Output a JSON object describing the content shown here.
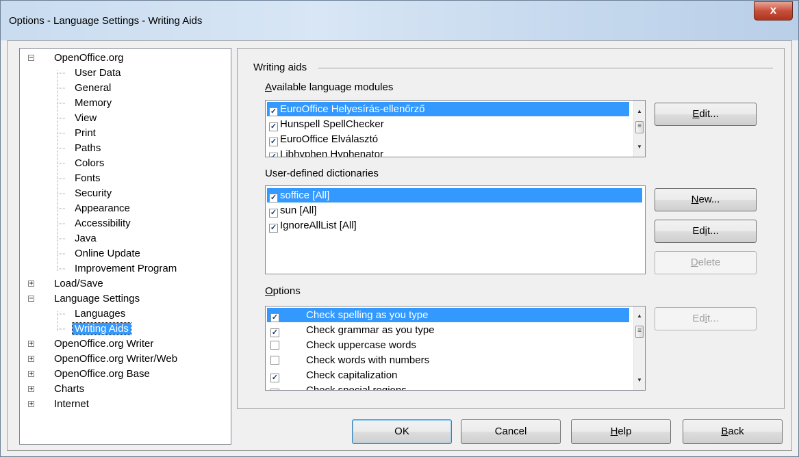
{
  "window": {
    "title": "Options - Language Settings - Writing Aids",
    "close_glyph": "x"
  },
  "tree": {
    "items": [
      {
        "label": "OpenOffice.org",
        "expander": "−"
      },
      {
        "label": "User Data"
      },
      {
        "label": "General"
      },
      {
        "label": "Memory"
      },
      {
        "label": "View"
      },
      {
        "label": "Print"
      },
      {
        "label": "Paths"
      },
      {
        "label": "Colors"
      },
      {
        "label": "Fonts"
      },
      {
        "label": "Security"
      },
      {
        "label": "Appearance"
      },
      {
        "label": "Accessibility"
      },
      {
        "label": "Java"
      },
      {
        "label": "Online Update"
      },
      {
        "label": "Improvement Program"
      },
      {
        "label": "Load/Save",
        "expander": "+"
      },
      {
        "label": "Language Settings",
        "expander": "−"
      },
      {
        "label": "Languages"
      },
      {
        "label": "Writing Aids",
        "selected": true
      },
      {
        "label": "OpenOffice.org Writer",
        "expander": "+"
      },
      {
        "label": "OpenOffice.org Writer/Web",
        "expander": "+"
      },
      {
        "label": "OpenOffice.org Base",
        "expander": "+"
      },
      {
        "label": "Charts",
        "expander": "+"
      },
      {
        "label": "Internet",
        "expander": "+"
      }
    ]
  },
  "panel": {
    "group_title": "Writing aids",
    "modules": {
      "label_prefix": "A",
      "label_rest": "vailable language modules",
      "items": [
        {
          "label": "EuroOffice Helyesírás-ellenőrző",
          "checked": true,
          "selected": true
        },
        {
          "label": "Hunspell SpellChecker",
          "checked": true
        },
        {
          "label": "EuroOffice Elválasztó",
          "checked": true
        },
        {
          "label": "Libhyphen Hyphenator",
          "checked": true
        }
      ],
      "edit_button": {
        "pre": "",
        "key": "E",
        "post": "dit..."
      }
    },
    "dictionaries": {
      "label": "User-defined dictionaries",
      "items": [
        {
          "label": "soffice [All]",
          "checked": true,
          "selected": true
        },
        {
          "label": "sun [All]",
          "checked": true
        },
        {
          "label": "IgnoreAllList [All]",
          "checked": true
        }
      ],
      "new_button": {
        "pre": "",
        "key": "N",
        "post": "ew..."
      },
      "edit_button": {
        "pre": "Ed",
        "key": "i",
        "post": "t..."
      },
      "delete_button": {
        "pre": "",
        "key": "D",
        "post": "elete"
      }
    },
    "options": {
      "label_prefix": "O",
      "label_rest": "ptions",
      "items": [
        {
          "label": "Check spelling as you type",
          "checked": true,
          "selected": true
        },
        {
          "label": "Check grammar as you type",
          "checked": true
        },
        {
          "label": "Check uppercase words",
          "checked": false
        },
        {
          "label": "Check words with numbers",
          "checked": false
        },
        {
          "label": "Check capitalization",
          "checked": true
        },
        {
          "label": "Check special regions",
          "checked": true
        }
      ],
      "edit_button": {
        "pre": "Ed",
        "key": "i",
        "post": "t..."
      }
    }
  },
  "footer": {
    "ok": "OK",
    "cancel": "Cancel",
    "help": {
      "key": "H",
      "rest": "elp"
    },
    "back": {
      "key": "B",
      "rest": "ack"
    }
  },
  "check_glyph": "✓",
  "colors": {
    "selection": "#3399ff",
    "title_bar": "#c9dcf0",
    "close_button": "#c7503a"
  }
}
